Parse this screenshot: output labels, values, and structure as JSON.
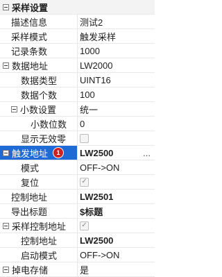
{
  "rows": {
    "caiji_shezhi": {
      "label": "采样设置"
    },
    "miaoshu_xinxi": {
      "label": "描述信息",
      "value": "测试2"
    },
    "caiyang_moshi": {
      "label": "采样模式",
      "value": "触发采样"
    },
    "jilu_tiaoshu": {
      "label": "记录条数",
      "value": "1000"
    },
    "shuju_dizhi": {
      "label": "数据地址",
      "value": "LW2000"
    },
    "shuju_leixing": {
      "label": "数据类型",
      "value": "UINT16"
    },
    "shuju_geshu": {
      "label": "数据个数",
      "value": "100"
    },
    "xiaoshu_shezhi": {
      "label": "小数设置",
      "value": "统一"
    },
    "xiaoshu_weishu": {
      "label": "小数位数",
      "value": "0"
    },
    "xianshi_wuxiaoling": {
      "label": "显示无效零"
    },
    "chufa_dizhi": {
      "label": "触发地址",
      "value": "LW2500",
      "badge": "1",
      "ellipsis": "..."
    },
    "moshi": {
      "label": "模式",
      "value": "OFF->ON"
    },
    "fuwei": {
      "label": "复位"
    },
    "kongzhi_dizhi": {
      "label": "控制地址",
      "value": "LW2501"
    },
    "daochu_biaoti": {
      "label": "导出标题",
      "value": "$标题"
    },
    "caiyang_kongzhi_dizhi": {
      "label": "采样控制地址"
    },
    "kongzhi_dizhi2": {
      "label": "控制地址",
      "value": "LW2500"
    },
    "qidong_moshi": {
      "label": "启动模式",
      "value": "OFF->ON"
    },
    "diaodian_cunchu": {
      "label": "掉电存储",
      "value": "是"
    }
  },
  "checks": {
    "checked_mark": "✓"
  }
}
